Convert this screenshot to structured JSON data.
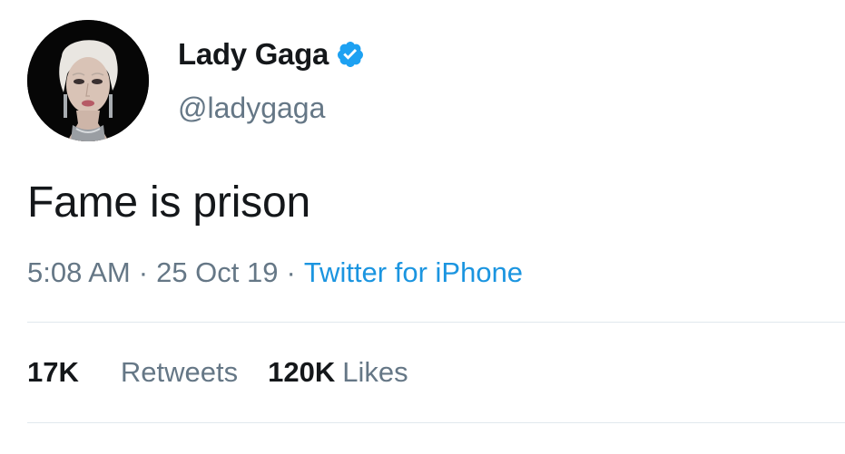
{
  "author": {
    "display_name": "Lady Gaga",
    "handle": "@ladygaga",
    "verified": true,
    "avatar_icon": "avatar-portrait"
  },
  "tweet": {
    "text": "Fame is prison"
  },
  "meta": {
    "time": "5:08 AM",
    "separator": "·",
    "date": "25 Oct 19",
    "source": "Twitter for iPhone"
  },
  "stats": {
    "retweets_count": "17K",
    "retweets_label": "Retweets",
    "likes_count": "120K",
    "likes_label": "Likes"
  },
  "colors": {
    "text_primary": "#14171a",
    "text_secondary": "#657786",
    "link": "#1b95e0",
    "verified_badge": "#1da1f2",
    "divider": "#e1e8ed"
  }
}
